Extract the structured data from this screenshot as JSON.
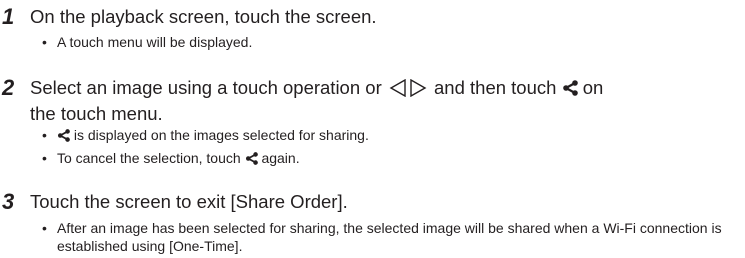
{
  "steps": [
    {
      "number": "1",
      "text": "On the playback screen, touch the screen.",
      "bullets": [
        "A touch menu will be displayed."
      ]
    },
    {
      "number": "2",
      "text_before_arrows": "Select an image using a touch operation or",
      "text_after_arrows": "and then touch",
      "text_on": "on",
      "text_line2": "the touch menu.",
      "bullets": [
        {
          "before_icon": "",
          "after_icon": "is displayed on the images selected for sharing."
        },
        {
          "before_icon": "To cancel the selection, touch",
          "after_icon": "again."
        }
      ]
    },
    {
      "number": "3",
      "text": "Touch the screen to exit [Share Order].",
      "bullets": [
        "After an image has been selected for sharing, the selected image will be shared when a Wi-Fi connection is established using [One-Time]."
      ]
    }
  ],
  "bullet_char": "•",
  "icons": {
    "share": "share-icon",
    "arrows": "left-right-arrow-keys-icon"
  }
}
